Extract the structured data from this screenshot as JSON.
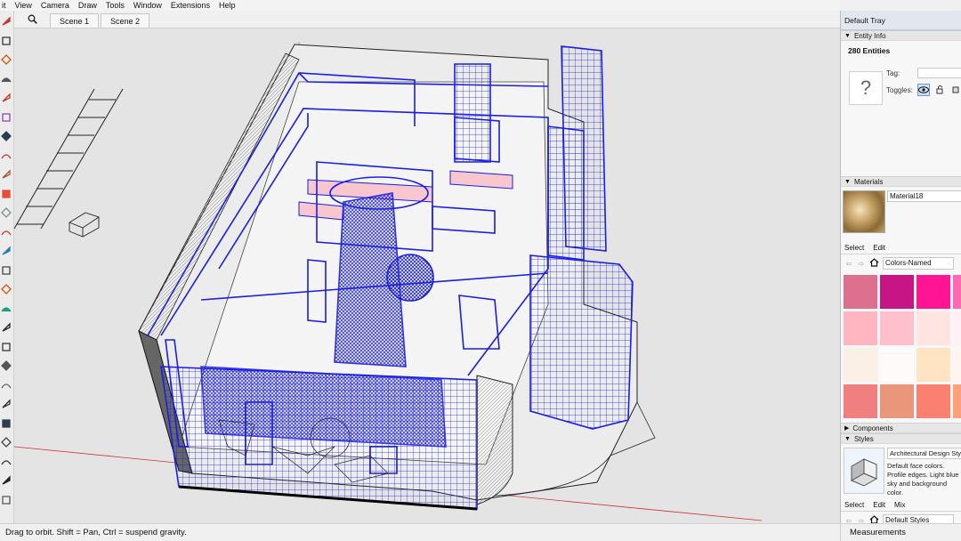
{
  "menu": [
    "it",
    "View",
    "Camera",
    "Draw",
    "Tools",
    "Window",
    "Extensions",
    "Help"
  ],
  "scenes": {
    "tabs": [
      "Scene 1",
      "Scene 2"
    ]
  },
  "tools": [
    "select-icon",
    "eraser-icon",
    "paint-bucket-icon",
    "tape-measure-icon",
    "line-icon",
    "freehand-icon",
    "rectangle-icon",
    "circle-icon",
    "arc-icon",
    "pie-icon",
    "push-pull-icon",
    "move-icon",
    "rotate-icon",
    "follow-me-icon",
    "scale-icon",
    "offset-icon",
    "axes-icon",
    "text-icon",
    "dimension-icon",
    "protractor-icon",
    "section-plane-icon",
    "orbit-icon",
    "pan-icon",
    "zoom-icon",
    "walk-icon",
    "look-around-icon"
  ],
  "status": {
    "hint": "Drag to orbit. Shift = Pan, Ctrl = suspend gravity.",
    "measurements_label": "Measurements"
  },
  "tray": {
    "title": "Default Tray",
    "entity_info": {
      "header": "Entity Info",
      "count": "280 Entities",
      "tag_label": "Tag:",
      "toggles_label": "Toggles:",
      "thumb_glyph": "?"
    },
    "materials": {
      "header": "Materials",
      "name": "Material18",
      "select_tab": "Select",
      "edit_tab": "Edit",
      "library": "Colors-Named",
      "swatches": [
        "#dd6f8f",
        "#c71585",
        "#ff1493",
        "#ff69b4",
        "#ffb6c1",
        "#ffc0cb",
        "#ffe4e1",
        "#fff0f5",
        "#faf0e6",
        "#fffafa",
        "#ffe4c4",
        "#fff5ee",
        "#f08080",
        "#e9967a",
        "#fa8072",
        "#ffa07a"
      ]
    },
    "components": {
      "header": "Components"
    },
    "styles": {
      "header": "Styles",
      "name": "Architectural Design Style",
      "description": "Default face colors. Profile edges. Light blue sky and background color.",
      "select_tab": "Select",
      "edit_tab": "Edit",
      "mix_tab": "Mix",
      "library": "Default Styles"
    }
  },
  "colors": {
    "wire": "#1a1ee6",
    "viewport_bg": "#e4e4e4",
    "pink_panel": "#f7c6cf"
  }
}
